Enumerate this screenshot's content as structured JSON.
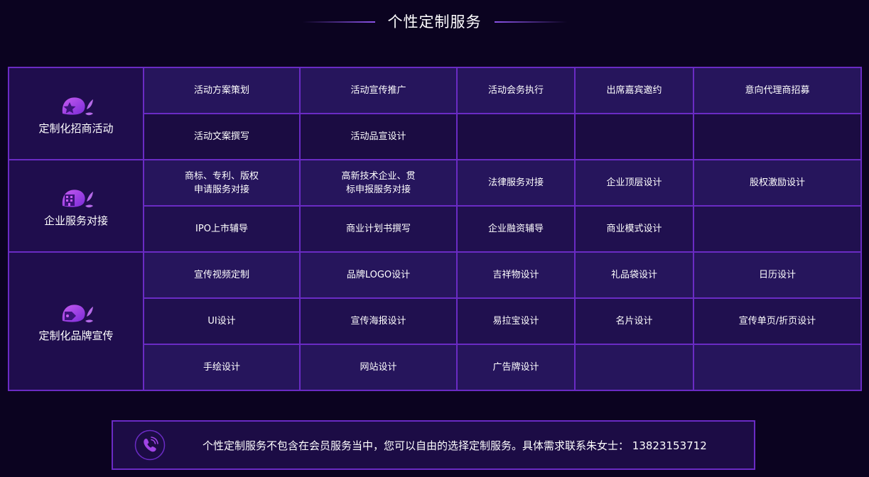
{
  "header": {
    "title": "个性定制服务"
  },
  "colors": {
    "background": "#0b0320",
    "border": "#6a2bc4",
    "accent": "#a044e6"
  },
  "sections": [
    {
      "category": "定制化招商活动",
      "icon": "star-leaf-icon",
      "rows": [
        [
          "活动方案策划",
          "活动宣传推广",
          "活动会务执行",
          "出席嘉宾邀约",
          "意向代理商招募"
        ],
        [
          "活动文案撰写",
          "活动品宣设计",
          "",
          "",
          ""
        ]
      ]
    },
    {
      "category": "企业服务对接",
      "icon": "building-leaf-icon",
      "rows": [
        [
          "商标、专利、版权\n申请服务对接",
          "高新技术企业、贯\n标申报服务对接",
          "法律服务对接",
          "企业顶层设计",
          "股权激励设计"
        ],
        [
          "IPO上市辅导",
          "商业计划书撰写",
          "企业融资辅导",
          "商业模式设计",
          ""
        ]
      ]
    },
    {
      "category": "定制化品牌宣传",
      "icon": "tag-leaf-icon",
      "rows": [
        [
          "宣传视频定制",
          "品牌LOGO设计",
          "吉祥物设计",
          "礼品袋设计",
          "日历设计"
        ],
        [
          "UI设计",
          "宣传海报设计",
          "易拉宝设计",
          "名片设计",
          "宣传单页/折页设计"
        ],
        [
          "手绘设计",
          "网站设计",
          "广告牌设计",
          "",
          ""
        ]
      ]
    }
  ],
  "footer": {
    "icon": "phone-icon",
    "note": "个性定制服务不包含在会员服务当中，您可以自由的选择定制服务。具体需求联系朱女士： 13823153712"
  }
}
